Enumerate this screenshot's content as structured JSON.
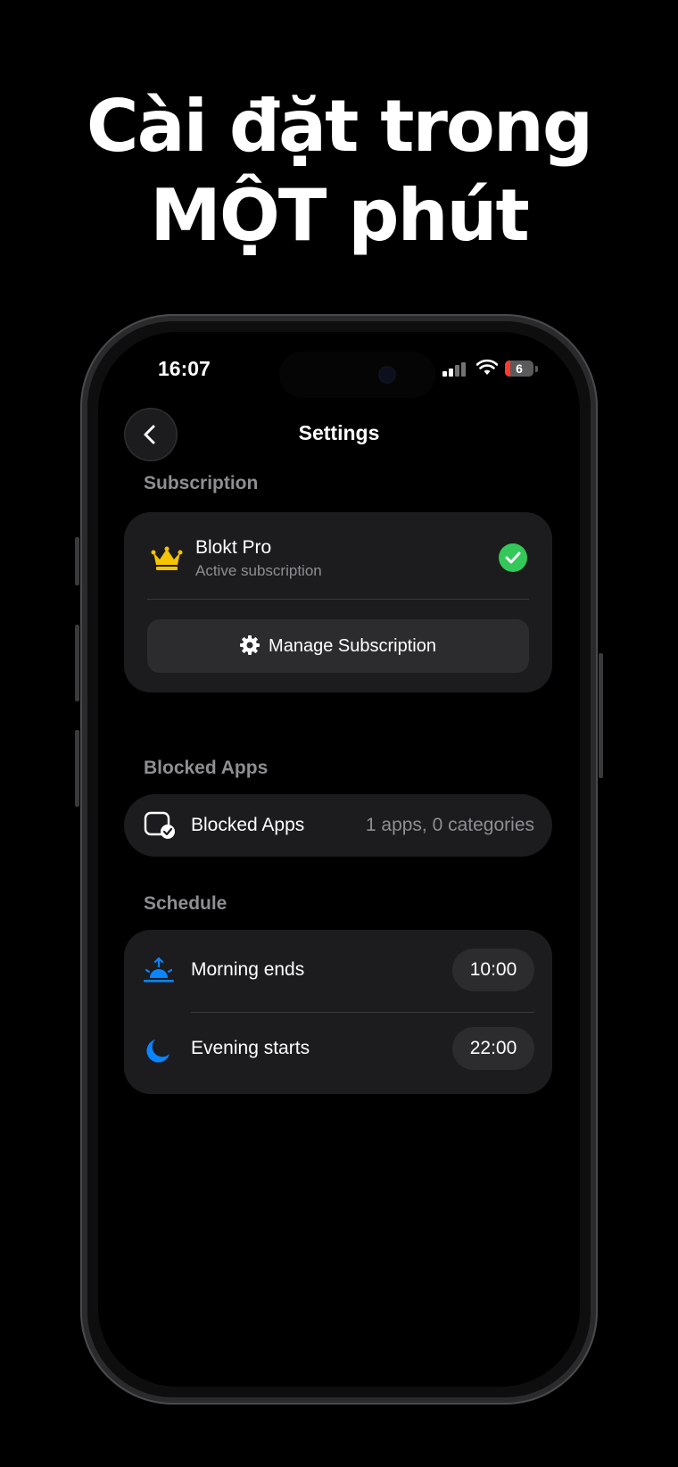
{
  "headline": {
    "line1": "Cài đặt trong",
    "line2": "MỘT phút"
  },
  "status_bar": {
    "time": "16:07",
    "battery": "6"
  },
  "nav": {
    "title": "Settings"
  },
  "subscription": {
    "section_label": "Subscription",
    "plan_name": "Blokt Pro",
    "plan_status": "Active subscription",
    "manage_label": "Manage Subscription"
  },
  "blocked_apps": {
    "section_label": "Blocked Apps",
    "row_label": "Blocked Apps",
    "row_value": "1 apps, 0 categories"
  },
  "schedule": {
    "section_label": "Schedule",
    "items": [
      {
        "label": "Morning ends",
        "time": "10:00",
        "icon": "sunrise-icon"
      },
      {
        "label": "Evening starts",
        "time": "22:00",
        "icon": "moon-icon"
      }
    ]
  },
  "colors": {
    "crown": "#f5c400",
    "check": "#34c759",
    "schedule_icon": "#0a84ff",
    "card_bg": "#1c1c1e",
    "secondary_text": "#8e8e93"
  }
}
